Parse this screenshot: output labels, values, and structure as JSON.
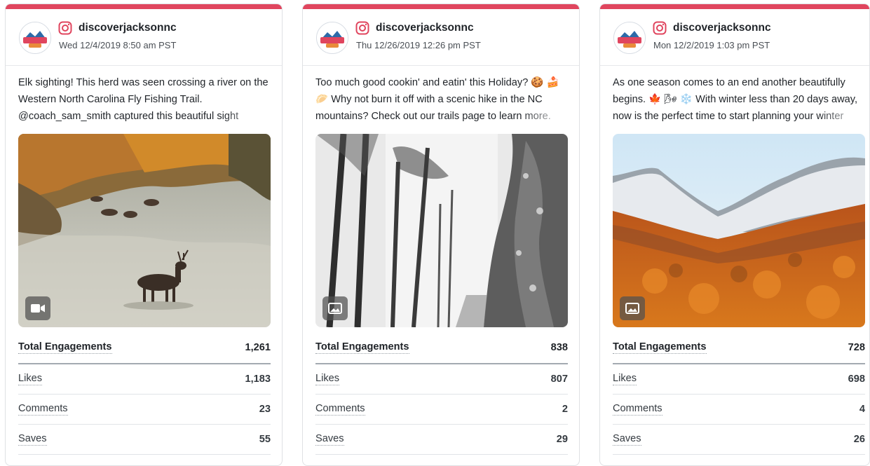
{
  "accent_color": "#e0455e",
  "platform_icon": "instagram-icon",
  "cards": [
    {
      "username": "discoverjacksonnc",
      "timestamp": "Wed 12/4/2019 8:50 am PST",
      "caption": "Elk sighting! This herd was seen crossing a river on the Western North Carolina Fly Fishing Trail. @coach_sam_smith captured this beautiful sight",
      "media_type_icon": "video-camera-icon",
      "metrics": [
        {
          "label": "Total Engagements",
          "value": "1,261"
        },
        {
          "label": "Likes",
          "value": "1,183"
        },
        {
          "label": "Comments",
          "value": "23"
        },
        {
          "label": "Saves",
          "value": "55"
        }
      ]
    },
    {
      "username": "discoverjacksonnc",
      "timestamp": "Thu 12/26/2019 12:26 pm PST",
      "caption": "Too much good cookin' and eatin' this Holiday? 🍪 🍰 🥟 Why not burn it off with a scenic hike in the NC mountains? Check out our trails page to learn more.",
      "media_type_icon": "image-icon",
      "metrics": [
        {
          "label": "Total Engagements",
          "value": "838"
        },
        {
          "label": "Likes",
          "value": "807"
        },
        {
          "label": "Comments",
          "value": "2"
        },
        {
          "label": "Saves",
          "value": "29"
        }
      ]
    },
    {
      "username": "discoverjacksonnc",
      "timestamp": "Mon 12/2/2019 1:03 pm PST",
      "caption": "As one season comes to an end another beautifully begins. 🍁 🌬 ❄️ With winter less than 20 days away, now is the perfect time to start planning your winter",
      "media_type_icon": "image-icon",
      "metrics": [
        {
          "label": "Total Engagements",
          "value": "728"
        },
        {
          "label": "Likes",
          "value": "698"
        },
        {
          "label": "Comments",
          "value": "4"
        },
        {
          "label": "Saves",
          "value": "26"
        }
      ]
    }
  ]
}
